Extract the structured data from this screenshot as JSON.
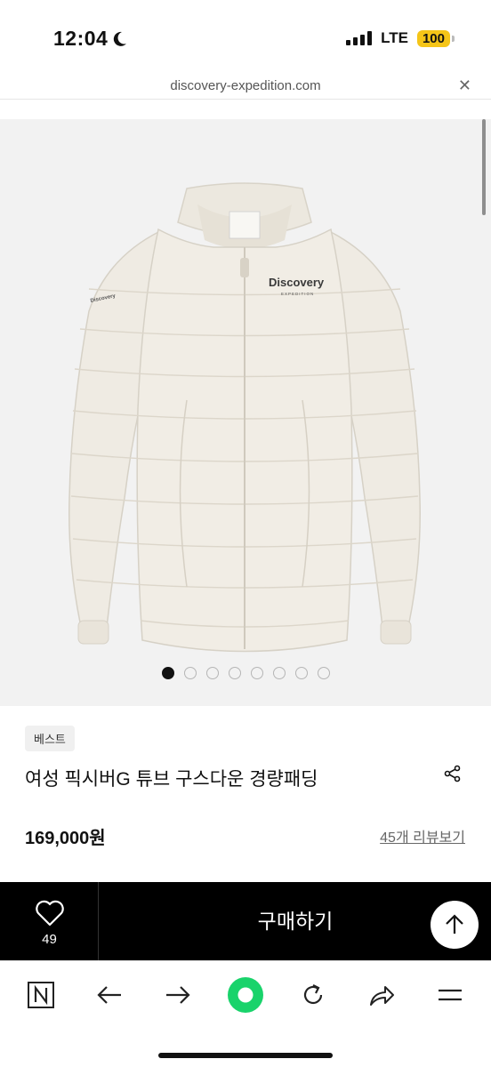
{
  "status_bar": {
    "time": "12:04",
    "network": "LTE",
    "battery": "100"
  },
  "browser": {
    "url": "discovery-expedition.com",
    "close_icon": "close-icon"
  },
  "gallery": {
    "image_count": 8,
    "active_index": 0,
    "logo_text": "Discovery",
    "logo_sub": "EXPEDITION"
  },
  "product": {
    "badge": "베스트",
    "title": "여성 픽시버G 튜브 구스다운 경량패딩",
    "price": "169,000원",
    "reviews_link": "45개 리뷰보기"
  },
  "purchase_bar": {
    "like_count": "49",
    "buy_label": "구매하기"
  },
  "toolbar": {
    "items": [
      "n-home-icon",
      "back-arrow-icon",
      "forward-arrow-icon",
      "green-dot-icon",
      "reload-icon",
      "share-arrow-icon",
      "menu-icon"
    ]
  },
  "colors": {
    "accent_green": "#19d36b",
    "buy_bar": "#000000",
    "battery": "#f5c518"
  }
}
